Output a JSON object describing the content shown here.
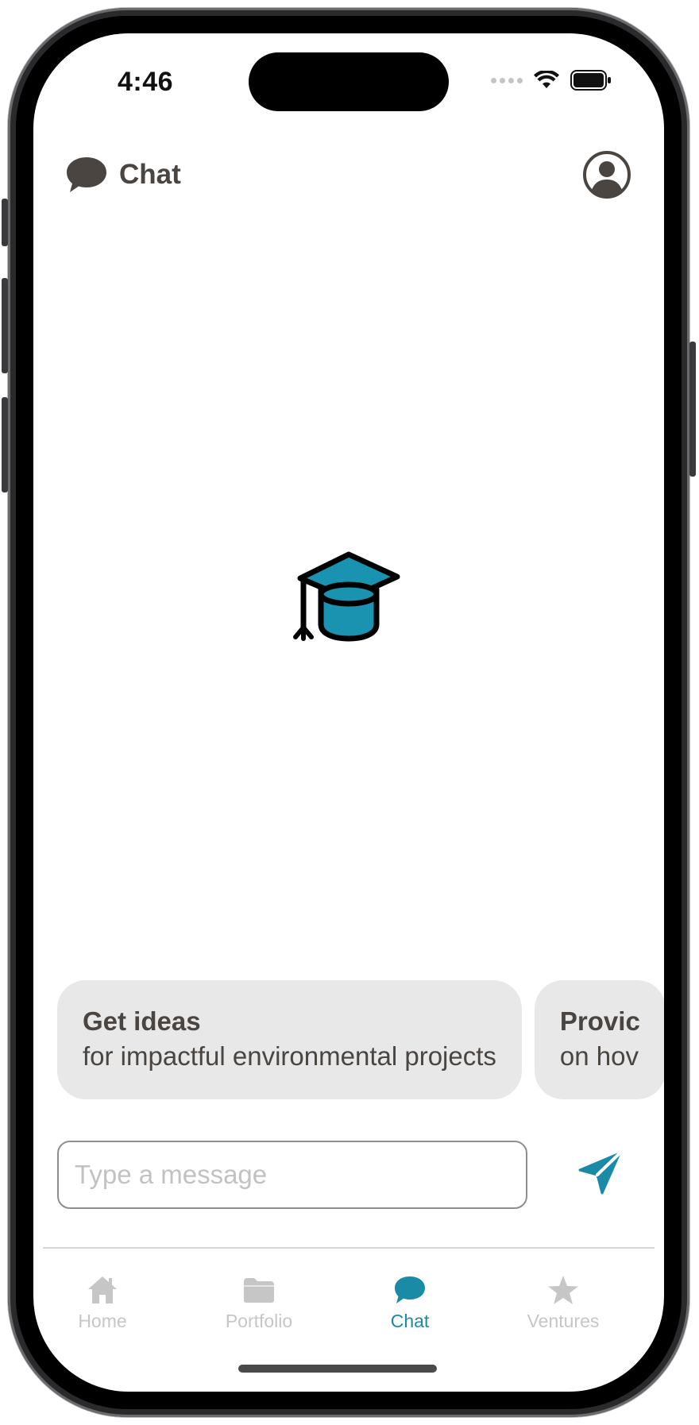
{
  "status_bar": {
    "time": "4:46"
  },
  "header": {
    "title": "Chat",
    "chat_icon": "chat-bubble-icon",
    "profile_icon": "profile-circle-icon"
  },
  "hero": {
    "icon": "graduation-cap-icon"
  },
  "suggestions": [
    {
      "title": "Get ideas",
      "subtitle": "for impactful environmental projects"
    },
    {
      "title": "Provic",
      "subtitle": "on hov"
    }
  ],
  "composer": {
    "placeholder": "Type a message",
    "value": "",
    "send_icon": "send-icon"
  },
  "tabbar": {
    "tabs": [
      {
        "label": "Home",
        "icon": "home-icon",
        "active": false
      },
      {
        "label": "Portfolio",
        "icon": "folder-icon",
        "active": false
      },
      {
        "label": "Chat",
        "icon": "chat-bubble-icon",
        "active": true
      },
      {
        "label": "Ventures",
        "icon": "star-icon",
        "active": false
      }
    ]
  },
  "colors": {
    "accent": "#1a8ba7",
    "text": "#4a4541",
    "inactive": "#c6c6c6",
    "chip_bg": "#e8e8e8"
  }
}
